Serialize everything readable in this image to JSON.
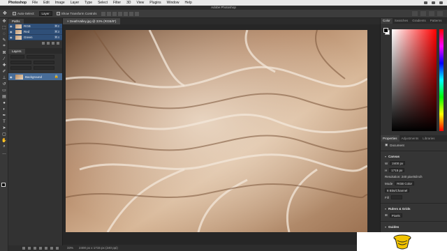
{
  "menubar": {
    "app": "Photoshop",
    "items": [
      "File",
      "Edit",
      "Image",
      "Layer",
      "Type",
      "Select",
      "Filter",
      "3D",
      "View",
      "Plugins",
      "Window",
      "Help"
    ]
  },
  "window": {
    "title": "Adobe Photoshop"
  },
  "options": {
    "auto_select_label": "Auto-Select:",
    "auto_select_value": "Layer",
    "transform_label": "Show Transform Controls"
  },
  "left_panel": {
    "channels_tab": "Paths",
    "channels": [
      {
        "name": "RGB",
        "shortcut": "⌘2"
      },
      {
        "name": "Red",
        "shortcut": "⌘3"
      },
      {
        "name": "Green",
        "shortcut": "⌘4"
      }
    ],
    "layers_tab": "Layers",
    "layer_name": "Background"
  },
  "document": {
    "tab_title": "DeathValley.jpg @ 33% (RGB/8*)",
    "zoom": "33%",
    "doc_info": "2400 px x 1715 px (240 ppi)"
  },
  "right_panel": {
    "tabs": [
      "Color",
      "Swatches",
      "Gradients",
      "Patterns"
    ],
    "properties_tabs": [
      "Properties",
      "Adjustments",
      "Libraries"
    ],
    "doc_label": "Document",
    "canvas_header": "Canvas",
    "w_label": "W",
    "w_value": "2400 px",
    "h_label": "H",
    "h_value": "1715 px",
    "resolution": "Resolution: 240 pixels/inch",
    "mode_label": "Mode",
    "mode_value": "RGB Color",
    "depth_value": "8 Bits/Channel",
    "fill_label": "Fill",
    "rulers_header": "Rulers & Grids",
    "rulers_unit": "Pixels",
    "guides_header": "Guides"
  },
  "colors": {
    "selection_blue": "#2f4f78",
    "layer_blue": "#486d99",
    "panel_bg": "#323232",
    "accent_red": "#ff0000"
  }
}
